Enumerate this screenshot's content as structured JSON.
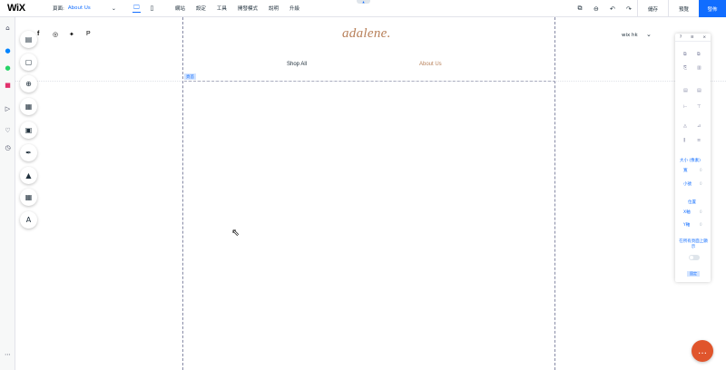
{
  "topbar": {
    "logo": "WiX",
    "page_label": "頁面:",
    "page_value": "About Us",
    "chevron": "⌄",
    "devices": [
      {
        "name": "desktop-icon",
        "glyph": "🖵"
      },
      {
        "name": "mobile-icon",
        "glyph": "▯"
      }
    ],
    "menu": [
      "網站",
      "設定",
      "工具",
      "開發模式",
      "說明",
      "升級"
    ],
    "save": "儲存",
    "preview": "預覽",
    "publish": "發佈",
    "handle_glyph": "▲"
  },
  "rail": {
    "icons": [
      {
        "name": "home-icon",
        "glyph": "⌂",
        "color": "#3b4057"
      },
      {
        "name": "messenger-icon",
        "glyph": "●",
        "color": "#0084ff"
      },
      {
        "name": "whatsapp-icon",
        "glyph": "●",
        "color": "#25d366"
      },
      {
        "name": "instagram-icon",
        "glyph": "■",
        "color": "#e1306c"
      },
      {
        "name": "send-icon",
        "glyph": "▷",
        "color": "#3b4057"
      },
      {
        "name": "heart-icon",
        "glyph": "♡",
        "color": "#3b4057"
      },
      {
        "name": "clock-icon",
        "glyph": "◷",
        "color": "#3b4057"
      },
      {
        "name": "more-icon",
        "glyph": "⋯",
        "color": "#3b4057"
      }
    ]
  },
  "tools": [
    {
      "name": "pages-icon",
      "glyph": "▤"
    },
    {
      "name": "background-icon",
      "glyph": "▢"
    },
    {
      "name": "add-icon",
      "glyph": "⊕"
    },
    {
      "name": "app-market-icon",
      "glyph": "▦"
    },
    {
      "name": "media-icon",
      "glyph": "▣"
    },
    {
      "name": "blog-icon",
      "glyph": "✒"
    },
    {
      "name": "store-icon",
      "glyph": "▲"
    },
    {
      "name": "table-icon",
      "glyph": "▦"
    },
    {
      "name": "fonts-icon",
      "glyph": "A"
    }
  ],
  "site": {
    "social": [
      {
        "name": "facebook-icon",
        "glyph": "f"
      },
      {
        "name": "instagram-social-icon",
        "glyph": "◎"
      },
      {
        "name": "twitter-icon",
        "glyph": "✦"
      },
      {
        "name": "pinterest-icon",
        "glyph": "P"
      }
    ],
    "brand": "adalene.",
    "nav": [
      "Shop All",
      "About Us"
    ],
    "language": "wix hk",
    "language_chevron": "⌄",
    "header_tag": "頁首"
  },
  "panel": {
    "head": [
      "?",
      "≡",
      "×"
    ],
    "size_label": "大小 (像素)",
    "width_label": "寬",
    "height_label": "小號",
    "position_label": "位置",
    "x_label": "X軸",
    "y_label": "Y軸",
    "show_all_pages_label": "在所有頁面上顯示",
    "button_label": "固定",
    "value_placeholder": "0"
  },
  "chat_glyph": "…",
  "cursor_glyph": "⇖"
}
